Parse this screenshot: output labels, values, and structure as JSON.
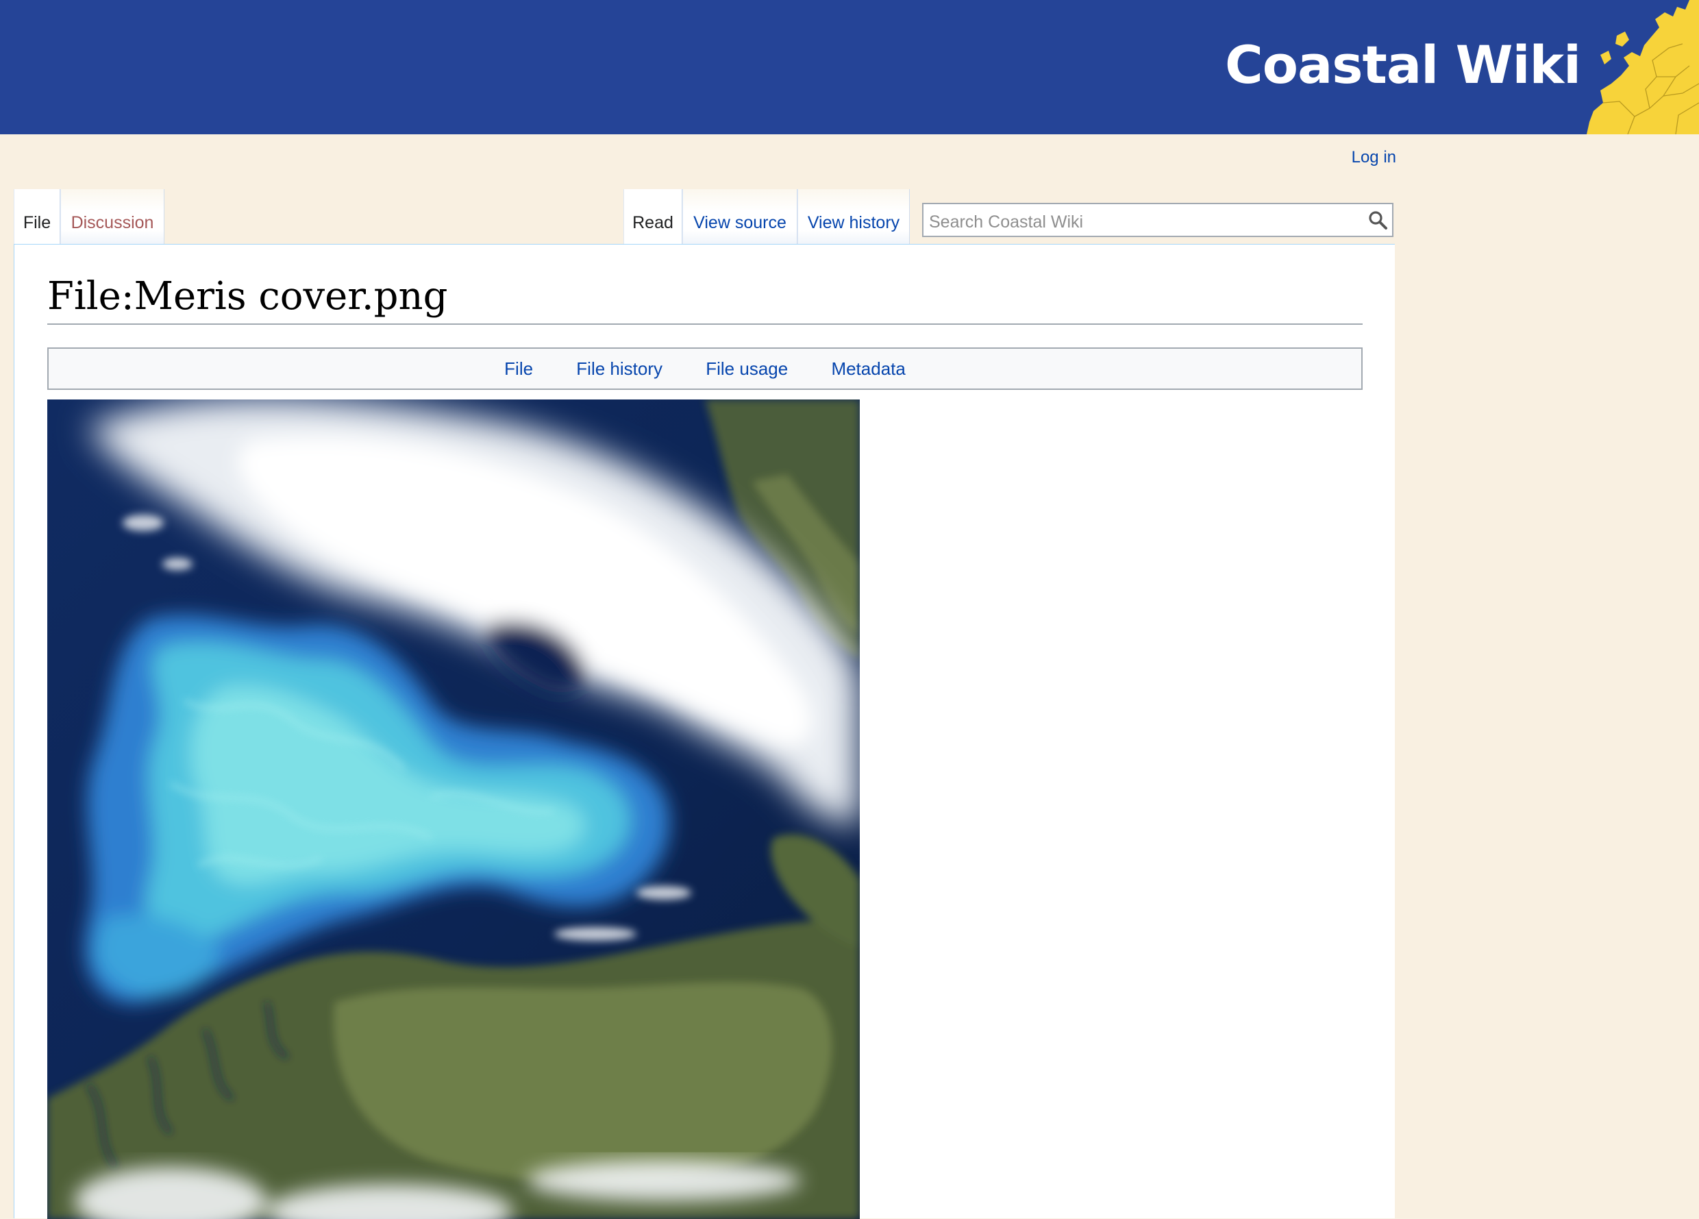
{
  "header": {
    "site_title": "Coastal Wiki",
    "bg_color": "#254497",
    "logo_icon": "europe-map-icon"
  },
  "personal_tools": {
    "login_label": "Log in"
  },
  "tabs": {
    "namespaces": [
      {
        "label": "File",
        "selected": true
      },
      {
        "label": "Discussion",
        "selected": false
      }
    ],
    "views": [
      {
        "label": "Read",
        "selected": true
      },
      {
        "label": "View source",
        "selected": false
      },
      {
        "label": "View history",
        "selected": false
      }
    ]
  },
  "search": {
    "placeholder": "Search Coastal Wiki",
    "value": "",
    "icon": "search-icon"
  },
  "page": {
    "title": "File:Meris cover.png",
    "file_toc": [
      "File",
      "File history",
      "File usage",
      "Metadata"
    ]
  },
  "colors": {
    "page_bg": "#f9f0e1",
    "link": "#0645ad",
    "new_link": "#a55858",
    "accent_yellow": "#f7d33a"
  }
}
